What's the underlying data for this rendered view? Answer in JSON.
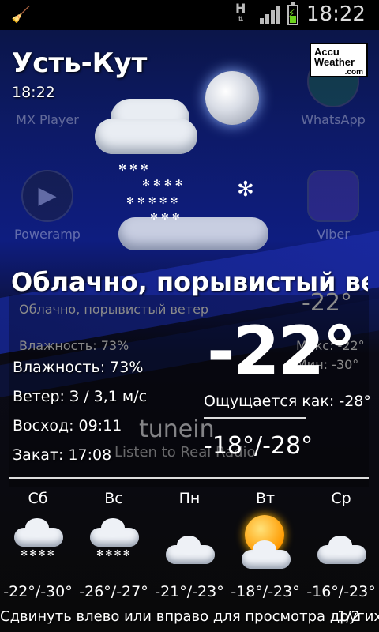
{
  "status": {
    "time": "18:22",
    "network": "H"
  },
  "header": {
    "city": "Усть-Кут",
    "updated": "18:22",
    "logo": [
      "Accu",
      "Weather",
      ".com"
    ]
  },
  "current": {
    "description": "Облачно, порывистый ветер",
    "temp": "-22°",
    "humidity": "Влажность: 73%",
    "wind": "Ветер: З / 3,1 м/с",
    "sunrise": "Восход: 09:11",
    "sunset": "Закат: 17:08",
    "feels_like": "Ощущается как: -28°",
    "range": "-18°/-28°"
  },
  "ghost": {
    "app_mx": "MX Player",
    "app_whatsapp": "WhatsApp",
    "app_poweramp": "Poweramp",
    "app_viber": "Viber",
    "desc_small": "Облачно, порывистый ветер",
    "humidity_small": "Влажность: 73%",
    "wind_small": "Ветер: З / 3,1 м/с",
    "temp_small": "-22°",
    "max_small": "Макс: -22°",
    "min_small": "Мин: -30°",
    "tunein": "tunein",
    "listen": "Listen to Real Radio"
  },
  "forecast": [
    {
      "day": "Сб",
      "range": "-22°/-30°",
      "icon": "snow-cloud-icon"
    },
    {
      "day": "Вс",
      "range": "-26°/-27°",
      "icon": "snow-cloud-icon"
    },
    {
      "day": "Пн",
      "range": "-21°/-23°",
      "icon": "cloud-icon"
    },
    {
      "day": "Вт",
      "range": "-18°/-23°",
      "icon": "sun-cloud-icon"
    },
    {
      "day": "Ср",
      "range": "-16°/-23°",
      "icon": "cloud-icon"
    }
  ],
  "footer": {
    "hint": "Сдвинуть влево или вправо для просмотра других мест",
    "page": "1/2"
  }
}
